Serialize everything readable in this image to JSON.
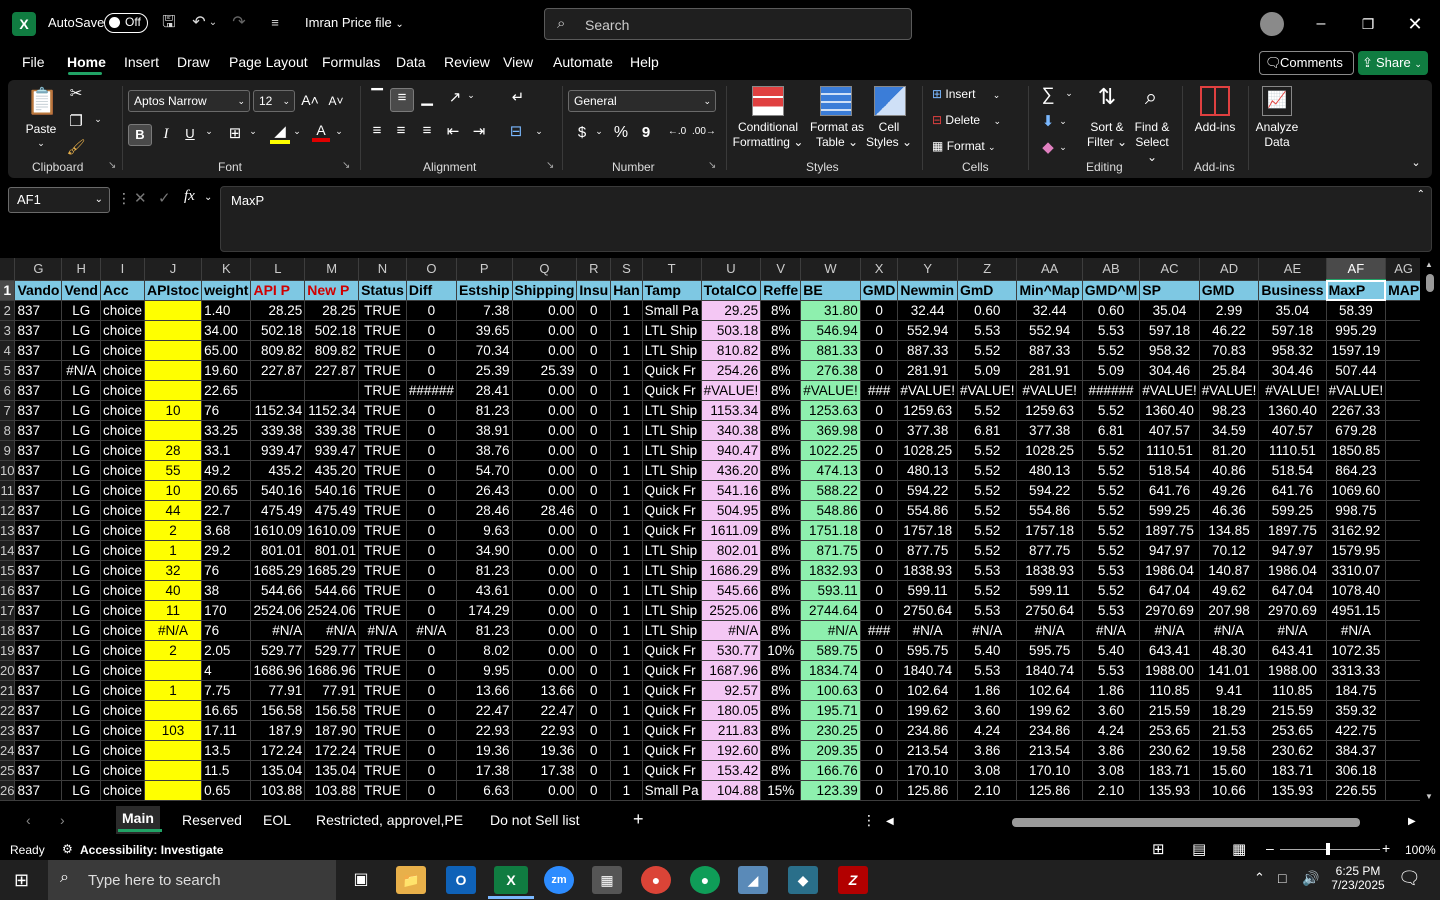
{
  "titlebar": {
    "app_letter": "X",
    "autosave_label": "AutoSave",
    "autosave_state": "Off",
    "filename": "Imran Price file",
    "search_placeholder": "Search"
  },
  "ribbon_tabs": [
    "File",
    "Home",
    "Insert",
    "Draw",
    "Page Layout",
    "Formulas",
    "Data",
    "Review",
    "View",
    "Automate",
    "Help"
  ],
  "active_tab": "Home",
  "actions": {
    "comments": "Comments",
    "share": "Share"
  },
  "ribbon": {
    "clipboard": {
      "label": "Clipboard",
      "paste": "Paste"
    },
    "font": {
      "label": "Font",
      "family": "Aptos Narrow",
      "size": "12",
      "bold": "B",
      "italic": "I",
      "underline": "U"
    },
    "alignment": {
      "label": "Alignment"
    },
    "number": {
      "label": "Number",
      "format": "General",
      "currency": "$",
      "percent": "%",
      "comma": "9"
    },
    "styles": {
      "label": "Styles",
      "conditional_1": "Conditional",
      "conditional_2": "Formatting",
      "format_table_1": "Format as",
      "format_table_2": "Table",
      "cell_styles_1": "Cell",
      "cell_styles_2": "Styles"
    },
    "cells": {
      "label": "Cells",
      "insert": "Insert",
      "delete": "Delete",
      "format": "Format"
    },
    "editing": {
      "label": "Editing",
      "sort_1": "Sort &",
      "sort_2": "Filter",
      "find_1": "Find &",
      "find_2": "Select"
    },
    "addins": {
      "label": "Add-ins",
      "addins": "Add-ins",
      "analyze_1": "Analyze",
      "analyze_2": "Data"
    }
  },
  "formula_bar": {
    "name_box": "AF1",
    "fx": "fx",
    "content": "MaxP"
  },
  "columns": [
    "G",
    "H",
    "I",
    "J",
    "K",
    "L",
    "M",
    "N",
    "O",
    "P",
    "Q",
    "R",
    "S",
    "T",
    "U",
    "V",
    "W",
    "X",
    "Y",
    "Z",
    "AA",
    "AB",
    "AC",
    "AD",
    "AE",
    "AF",
    "AG"
  ],
  "header_row": [
    "Vando",
    "Vend",
    "Acc",
    "APIstoc",
    "weight",
    "API P",
    "New P",
    "Status",
    "Diff",
    "Estship",
    "Shipping",
    "Insu",
    "Han",
    "Tamp",
    "TotalCO",
    "Reffe",
    "BE",
    "GMD",
    "Newmin",
    "GmD",
    "Min^Map",
    "GMD^M",
    "SP",
    "GMD",
    "Business",
    "MaxP",
    "MAP"
  ],
  "rows": [
    [
      "2",
      "837",
      "LG",
      "choice",
      "",
      "1.40",
      "28.25",
      "28.25",
      "TRUE",
      "0",
      "7.38",
      "0.00",
      "0",
      "1",
      "Small Pa",
      "29.25",
      "8%",
      "31.80",
      "0",
      "32.44",
      "0.60",
      "32.44",
      "0.60",
      "35.04",
      "2.99",
      "35.04",
      "58.39",
      ""
    ],
    [
      "3",
      "837",
      "LG",
      "choice",
      "",
      "34.00",
      "502.18",
      "502.18",
      "TRUE",
      "0",
      "39.65",
      "0.00",
      "0",
      "1",
      "LTL Ship",
      "503.18",
      "8%",
      "546.94",
      "0",
      "552.94",
      "5.53",
      "552.94",
      "5.53",
      "597.18",
      "46.22",
      "597.18",
      "995.29",
      ""
    ],
    [
      "4",
      "837",
      "LG",
      "choice",
      "",
      "65.00",
      "809.82",
      "809.82",
      "TRUE",
      "0",
      "70.34",
      "0.00",
      "0",
      "1",
      "LTL Ship",
      "810.82",
      "8%",
      "881.33",
      "0",
      "887.33",
      "5.52",
      "887.33",
      "5.52",
      "958.32",
      "70.83",
      "958.32",
      "1597.19",
      ""
    ],
    [
      "5",
      "837",
      "#N/A",
      "choice",
      "",
      "19.60",
      "227.87",
      "227.87",
      "TRUE",
      "0",
      "25.39",
      "25.39",
      "0",
      "1",
      "Quick Fr",
      "254.26",
      "8%",
      "276.38",
      "0",
      "281.91",
      "5.09",
      "281.91",
      "5.09",
      "304.46",
      "25.84",
      "304.46",
      "507.44",
      ""
    ],
    [
      "6",
      "837",
      "LG",
      "choice",
      "",
      "22.65",
      "",
      "",
      "TRUE",
      "######",
      "28.41",
      "0.00",
      "0",
      "1",
      "Quick Fr",
      "#VALUE!",
      "8%",
      "#VALUE!",
      "###",
      "#VALUE!",
      "#VALUE!",
      "#VALUE!",
      "######",
      "#VALUE!",
      "#VALUE!",
      "#VALUE!",
      "#VALUE!",
      ""
    ],
    [
      "7",
      "837",
      "LG",
      "choice",
      "10",
      "76",
      "1152.34",
      "1152.34",
      "TRUE",
      "0",
      "81.23",
      "0.00",
      "0",
      "1",
      "LTL Ship",
      "1153.34",
      "8%",
      "1253.63",
      "0",
      "1259.63",
      "5.52",
      "1259.63",
      "5.52",
      "1360.40",
      "98.23",
      "1360.40",
      "2267.33",
      ""
    ],
    [
      "8",
      "837",
      "LG",
      "choice",
      "",
      "33.25",
      "339.38",
      "339.38",
      "TRUE",
      "0",
      "38.91",
      "0.00",
      "0",
      "1",
      "LTL Ship",
      "340.38",
      "8%",
      "369.98",
      "0",
      "377.38",
      "6.81",
      "377.38",
      "6.81",
      "407.57",
      "34.59",
      "407.57",
      "679.28",
      ""
    ],
    [
      "9",
      "837",
      "LG",
      "choice",
      "28",
      "33.1",
      "939.47",
      "939.47",
      "TRUE",
      "0",
      "38.76",
      "0.00",
      "0",
      "1",
      "LTL Ship",
      "940.47",
      "8%",
      "1022.25",
      "0",
      "1028.25",
      "5.52",
      "1028.25",
      "5.52",
      "1110.51",
      "81.20",
      "1110.51",
      "1850.85",
      ""
    ],
    [
      "10",
      "837",
      "LG",
      "choice",
      "55",
      "49.2",
      "435.2",
      "435.20",
      "TRUE",
      "0",
      "54.70",
      "0.00",
      "0",
      "1",
      "LTL Ship",
      "436.20",
      "8%",
      "474.13",
      "0",
      "480.13",
      "5.52",
      "480.13",
      "5.52",
      "518.54",
      "40.86",
      "518.54",
      "864.23",
      ""
    ],
    [
      "11",
      "837",
      "LG",
      "choice",
      "10",
      "20.65",
      "540.16",
      "540.16",
      "TRUE",
      "0",
      "26.43",
      "0.00",
      "0",
      "1",
      "Quick Fr",
      "541.16",
      "8%",
      "588.22",
      "0",
      "594.22",
      "5.52",
      "594.22",
      "5.52",
      "641.76",
      "49.26",
      "641.76",
      "1069.60",
      ""
    ],
    [
      "12",
      "837",
      "LG",
      "choice",
      "44",
      "22.7",
      "475.49",
      "475.49",
      "TRUE",
      "0",
      "28.46",
      "28.46",
      "0",
      "1",
      "Quick Fr",
      "504.95",
      "8%",
      "548.86",
      "0",
      "554.86",
      "5.52",
      "554.86",
      "5.52",
      "599.25",
      "46.36",
      "599.25",
      "998.75",
      ""
    ],
    [
      "13",
      "837",
      "LG",
      "choice",
      "2",
      "3.68",
      "1610.09",
      "1610.09",
      "TRUE",
      "0",
      "9.63",
      "0.00",
      "0",
      "1",
      "Quick Fr",
      "1611.09",
      "8%",
      "1751.18",
      "0",
      "1757.18",
      "5.52",
      "1757.18",
      "5.52",
      "1897.75",
      "134.85",
      "1897.75",
      "3162.92",
      ""
    ],
    [
      "14",
      "837",
      "LG",
      "choice",
      "1",
      "29.2",
      "801.01",
      "801.01",
      "TRUE",
      "0",
      "34.90",
      "0.00",
      "0",
      "1",
      "LTL Ship",
      "802.01",
      "8%",
      "871.75",
      "0",
      "877.75",
      "5.52",
      "877.75",
      "5.52",
      "947.97",
      "70.12",
      "947.97",
      "1579.95",
      ""
    ],
    [
      "15",
      "837",
      "LG",
      "choice",
      "32",
      "76",
      "1685.29",
      "1685.29",
      "TRUE",
      "0",
      "81.23",
      "0.00",
      "0",
      "1",
      "LTL Ship",
      "1686.29",
      "8%",
      "1832.93",
      "0",
      "1838.93",
      "5.53",
      "1838.93",
      "5.53",
      "1986.04",
      "140.87",
      "1986.04",
      "3310.07",
      ""
    ],
    [
      "16",
      "837",
      "LG",
      "choice",
      "40",
      "38",
      "544.66",
      "544.66",
      "TRUE",
      "0",
      "43.61",
      "0.00",
      "0",
      "1",
      "LTL Ship",
      "545.66",
      "8%",
      "593.11",
      "0",
      "599.11",
      "5.52",
      "599.11",
      "5.52",
      "647.04",
      "49.62",
      "647.04",
      "1078.40",
      ""
    ],
    [
      "17",
      "837",
      "LG",
      "choice",
      "11",
      "170",
      "2524.06",
      "2524.06",
      "TRUE",
      "0",
      "174.29",
      "0.00",
      "0",
      "1",
      "LTL Ship",
      "2525.06",
      "8%",
      "2744.64",
      "0",
      "2750.64",
      "5.53",
      "2750.64",
      "5.53",
      "2970.69",
      "207.98",
      "2970.69",
      "4951.15",
      ""
    ],
    [
      "18",
      "837",
      "LG",
      "choice",
      "#N/A",
      "76",
      "#N/A",
      "#N/A",
      "#N/A",
      "#N/A",
      "81.23",
      "0.00",
      "0",
      "1",
      "LTL Ship",
      "#N/A",
      "8%",
      "#N/A",
      "###",
      "#N/A",
      "#N/A",
      "#N/A",
      "#N/A",
      "#N/A",
      "#N/A",
      "#N/A",
      "#N/A",
      ""
    ],
    [
      "19",
      "837",
      "LG",
      "choice",
      "2",
      "2.05",
      "529.77",
      "529.77",
      "TRUE",
      "0",
      "8.02",
      "0.00",
      "0",
      "1",
      "Quick Fr",
      "530.77",
      "10%",
      "589.75",
      "0",
      "595.75",
      "5.40",
      "595.75",
      "5.40",
      "643.41",
      "48.30",
      "643.41",
      "1072.35",
      ""
    ],
    [
      "20",
      "837",
      "LG",
      "choice",
      "",
      "4",
      "1686.96",
      "1686.96",
      "TRUE",
      "0",
      "9.95",
      "0.00",
      "0",
      "1",
      "Quick Fr",
      "1687.96",
      "8%",
      "1834.74",
      "0",
      "1840.74",
      "5.53",
      "1840.74",
      "5.53",
      "1988.00",
      "141.01",
      "1988.00",
      "3313.33",
      ""
    ],
    [
      "21",
      "837",
      "LG",
      "choice",
      "1",
      "7.75",
      "77.91",
      "77.91",
      "TRUE",
      "0",
      "13.66",
      "13.66",
      "0",
      "1",
      "Quick Fr",
      "92.57",
      "8%",
      "100.63",
      "0",
      "102.64",
      "1.86",
      "102.64",
      "1.86",
      "110.85",
      "9.41",
      "110.85",
      "184.75",
      ""
    ],
    [
      "22",
      "837",
      "LG",
      "choice",
      "",
      "16.65",
      "156.58",
      "156.58",
      "TRUE",
      "0",
      "22.47",
      "22.47",
      "0",
      "1",
      "Quick Fr",
      "180.05",
      "8%",
      "195.71",
      "0",
      "199.62",
      "3.60",
      "199.62",
      "3.60",
      "215.59",
      "18.29",
      "215.59",
      "359.32",
      ""
    ],
    [
      "23",
      "837",
      "LG",
      "choice",
      "103",
      "17.11",
      "187.9",
      "187.90",
      "TRUE",
      "0",
      "22.93",
      "22.93",
      "0",
      "1",
      "Quick Fr",
      "211.83",
      "8%",
      "230.25",
      "0",
      "234.86",
      "4.24",
      "234.86",
      "4.24",
      "253.65",
      "21.53",
      "253.65",
      "422.75",
      ""
    ],
    [
      "24",
      "837",
      "LG",
      "choice",
      "",
      "13.5",
      "172.24",
      "172.24",
      "TRUE",
      "0",
      "19.36",
      "19.36",
      "0",
      "1",
      "Quick Fr",
      "192.60",
      "8%",
      "209.35",
      "0",
      "213.54",
      "3.86",
      "213.54",
      "3.86",
      "230.62",
      "19.58",
      "230.62",
      "384.37",
      ""
    ],
    [
      "25",
      "837",
      "LG",
      "choice",
      "",
      "11.5",
      "135.04",
      "135.04",
      "TRUE",
      "0",
      "17.38",
      "17.38",
      "0",
      "1",
      "Quick Fr",
      "153.42",
      "8%",
      "166.76",
      "0",
      "170.10",
      "3.08",
      "170.10",
      "3.08",
      "183.71",
      "15.60",
      "183.71",
      "306.18",
      ""
    ],
    [
      "26",
      "837",
      "LG",
      "choice",
      "",
      "0.65",
      "103.88",
      "103.88",
      "TRUE",
      "0",
      "6.63",
      "0.00",
      "0",
      "1",
      "Small Pa",
      "104.88",
      "15%",
      "123.39",
      "0",
      "125.86",
      "2.10",
      "125.86",
      "2.10",
      "135.93",
      "10.66",
      "135.93",
      "226.55",
      ""
    ]
  ],
  "sheet_tabs": [
    "Main",
    "Reserved",
    "EOL",
    "Restricted, approvel,PE",
    "Do not Sell list"
  ],
  "active_sheet": "Main",
  "status": {
    "ready": "Ready",
    "accessibility": "Accessibility: Investigate",
    "zoom": "100%"
  },
  "taskbar": {
    "search_placeholder": "Type here to search",
    "time": "6:25 PM",
    "date": "7/23/2025"
  },
  "colors": {
    "header_fill": "#7ec8e3",
    "yellow_col": "#ffff00",
    "pink_col": "#f4c7f4",
    "green_col": "#8ef0ae",
    "excel_green": "#107c41"
  }
}
